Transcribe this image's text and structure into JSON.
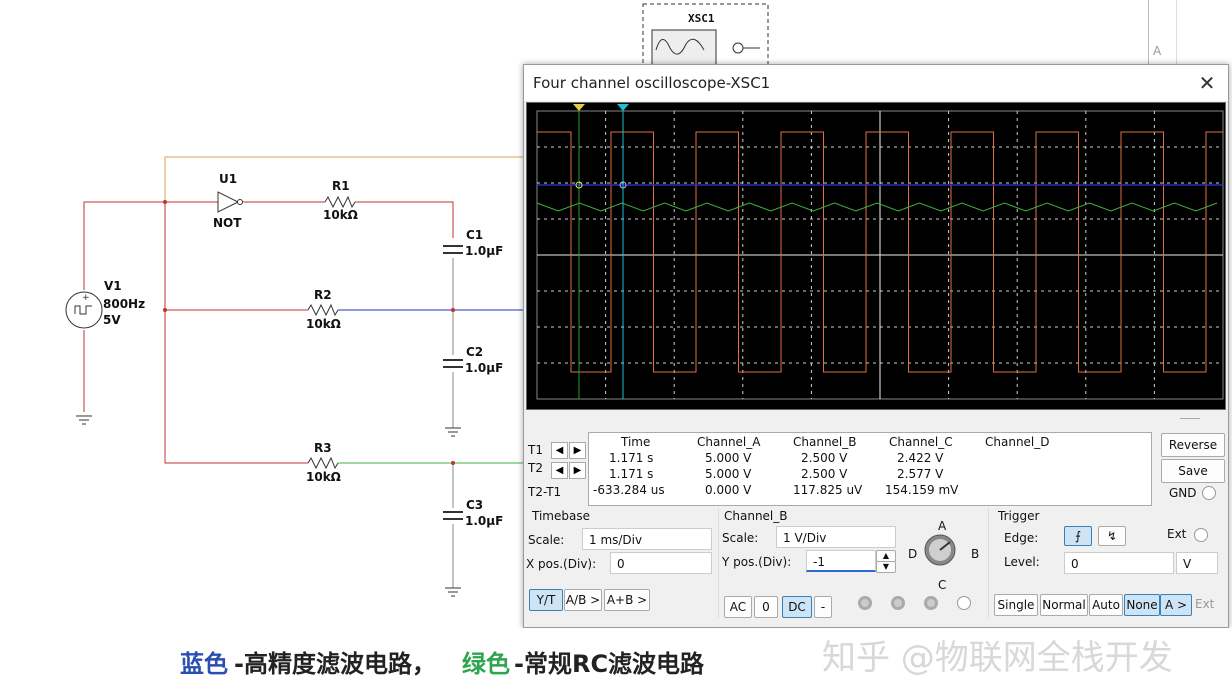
{
  "schematic": {
    "scope_icon_label": "XSC1",
    "gate": {
      "ref": "U1",
      "type": "NOT"
    },
    "source": {
      "ref": "V1",
      "freq": "800Hz",
      "amp": "5V"
    },
    "resistors": [
      {
        "ref": "R1",
        "value": "10kΩ"
      },
      {
        "ref": "R2",
        "value": "10kΩ"
      },
      {
        "ref": "R3",
        "value": "10kΩ"
      }
    ],
    "capacitors": [
      {
        "ref": "C1",
        "value": "1.0μF"
      },
      {
        "ref": "C2",
        "value": "1.0μF"
      },
      {
        "ref": "C3",
        "value": "1.0μF"
      }
    ],
    "right_strip_label": "A"
  },
  "window": {
    "title": "Four channel oscilloscope-XSC1",
    "close_icon": "close-icon"
  },
  "colors": {
    "channel_a": "#e07040",
    "channel_b": "#2030c0",
    "channel_c": "#40b040",
    "cursor1": "#20a020",
    "cursor2": "#20c0d0",
    "grid": "#cfcfcf"
  },
  "readout": {
    "headers": [
      "Time",
      "Channel_A",
      "Channel_B",
      "Channel_C",
      "Channel_D"
    ],
    "rows": [
      {
        "label": "T1",
        "values": [
          "1.171 s",
          "5.000 V",
          "2.500 V",
          "2.422 V",
          ""
        ]
      },
      {
        "label": "T2",
        "values": [
          "1.171 s",
          "5.000 V",
          "2.500 V",
          "2.577 V",
          ""
        ]
      },
      {
        "label": "T2-T1",
        "values": [
          "-633.284 us",
          "0.000 V",
          "117.825 uV",
          "154.159 mV",
          ""
        ]
      }
    ],
    "reverse_label": "Reverse",
    "save_label": "Save",
    "gnd_label": "GND"
  },
  "timebase": {
    "title": "Timebase",
    "scale_label": "Scale:",
    "scale_value": "1 ms/Div",
    "xpos_label": "X pos.(Div):",
    "xpos_value": "0",
    "yt": "Y/T",
    "ab": "A/B >",
    "apb": "A+B >"
  },
  "channel": {
    "title": "Channel_B",
    "scale_label": "Scale:",
    "scale_value": "1  V/Div",
    "ypos_label": "Y pos.(Div):",
    "ypos_value": "-1",
    "ac": "AC",
    "zero": "0",
    "dc": "DC",
    "minus": "-",
    "knob_a": "A",
    "knob_b": "B",
    "knob_c": "C",
    "knob_d": "D"
  },
  "trigger": {
    "title": "Trigger",
    "edge_label": "Edge:",
    "ext_label": "Ext",
    "level_label": "Level:",
    "level_value": "0",
    "level_unit": "V",
    "single": "Single",
    "normal": "Normal",
    "auto": "Auto",
    "none": "None",
    "a": "A >",
    "ext": "Ext"
  },
  "caption": {
    "blue": "蓝色",
    "mid1": "-高精度滤波电路，",
    "green": "绿色",
    "mid2": "-常规RC滤波电路"
  },
  "watermark": "知乎 @物联网全栈开发"
}
